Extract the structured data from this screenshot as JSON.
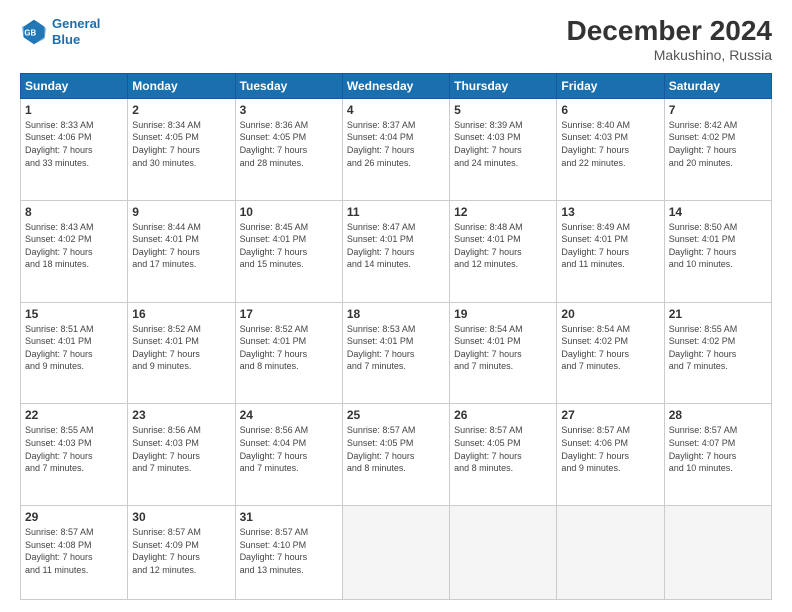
{
  "header": {
    "logo_line1": "General",
    "logo_line2": "Blue",
    "month": "December 2024",
    "location": "Makushino, Russia"
  },
  "weekdays": [
    "Sunday",
    "Monday",
    "Tuesday",
    "Wednesday",
    "Thursday",
    "Friday",
    "Saturday"
  ],
  "weeks": [
    [
      {
        "day": "1",
        "info": "Sunrise: 8:33 AM\nSunset: 4:06 PM\nDaylight: 7 hours\nand 33 minutes."
      },
      {
        "day": "2",
        "info": "Sunrise: 8:34 AM\nSunset: 4:05 PM\nDaylight: 7 hours\nand 30 minutes."
      },
      {
        "day": "3",
        "info": "Sunrise: 8:36 AM\nSunset: 4:05 PM\nDaylight: 7 hours\nand 28 minutes."
      },
      {
        "day": "4",
        "info": "Sunrise: 8:37 AM\nSunset: 4:04 PM\nDaylight: 7 hours\nand 26 minutes."
      },
      {
        "day": "5",
        "info": "Sunrise: 8:39 AM\nSunset: 4:03 PM\nDaylight: 7 hours\nand 24 minutes."
      },
      {
        "day": "6",
        "info": "Sunrise: 8:40 AM\nSunset: 4:03 PM\nDaylight: 7 hours\nand 22 minutes."
      },
      {
        "day": "7",
        "info": "Sunrise: 8:42 AM\nSunset: 4:02 PM\nDaylight: 7 hours\nand 20 minutes."
      }
    ],
    [
      {
        "day": "8",
        "info": "Sunrise: 8:43 AM\nSunset: 4:02 PM\nDaylight: 7 hours\nand 18 minutes."
      },
      {
        "day": "9",
        "info": "Sunrise: 8:44 AM\nSunset: 4:01 PM\nDaylight: 7 hours\nand 17 minutes."
      },
      {
        "day": "10",
        "info": "Sunrise: 8:45 AM\nSunset: 4:01 PM\nDaylight: 7 hours\nand 15 minutes."
      },
      {
        "day": "11",
        "info": "Sunrise: 8:47 AM\nSunset: 4:01 PM\nDaylight: 7 hours\nand 14 minutes."
      },
      {
        "day": "12",
        "info": "Sunrise: 8:48 AM\nSunset: 4:01 PM\nDaylight: 7 hours\nand 12 minutes."
      },
      {
        "day": "13",
        "info": "Sunrise: 8:49 AM\nSunset: 4:01 PM\nDaylight: 7 hours\nand 11 minutes."
      },
      {
        "day": "14",
        "info": "Sunrise: 8:50 AM\nSunset: 4:01 PM\nDaylight: 7 hours\nand 10 minutes."
      }
    ],
    [
      {
        "day": "15",
        "info": "Sunrise: 8:51 AM\nSunset: 4:01 PM\nDaylight: 7 hours\nand 9 minutes."
      },
      {
        "day": "16",
        "info": "Sunrise: 8:52 AM\nSunset: 4:01 PM\nDaylight: 7 hours\nand 9 minutes."
      },
      {
        "day": "17",
        "info": "Sunrise: 8:52 AM\nSunset: 4:01 PM\nDaylight: 7 hours\nand 8 minutes."
      },
      {
        "day": "18",
        "info": "Sunrise: 8:53 AM\nSunset: 4:01 PM\nDaylight: 7 hours\nand 7 minutes."
      },
      {
        "day": "19",
        "info": "Sunrise: 8:54 AM\nSunset: 4:01 PM\nDaylight: 7 hours\nand 7 minutes."
      },
      {
        "day": "20",
        "info": "Sunrise: 8:54 AM\nSunset: 4:02 PM\nDaylight: 7 hours\nand 7 minutes."
      },
      {
        "day": "21",
        "info": "Sunrise: 8:55 AM\nSunset: 4:02 PM\nDaylight: 7 hours\nand 7 minutes."
      }
    ],
    [
      {
        "day": "22",
        "info": "Sunrise: 8:55 AM\nSunset: 4:03 PM\nDaylight: 7 hours\nand 7 minutes."
      },
      {
        "day": "23",
        "info": "Sunrise: 8:56 AM\nSunset: 4:03 PM\nDaylight: 7 hours\nand 7 minutes."
      },
      {
        "day": "24",
        "info": "Sunrise: 8:56 AM\nSunset: 4:04 PM\nDaylight: 7 hours\nand 7 minutes."
      },
      {
        "day": "25",
        "info": "Sunrise: 8:57 AM\nSunset: 4:05 PM\nDaylight: 7 hours\nand 8 minutes."
      },
      {
        "day": "26",
        "info": "Sunrise: 8:57 AM\nSunset: 4:05 PM\nDaylight: 7 hours\nand 8 minutes."
      },
      {
        "day": "27",
        "info": "Sunrise: 8:57 AM\nSunset: 4:06 PM\nDaylight: 7 hours\nand 9 minutes."
      },
      {
        "day": "28",
        "info": "Sunrise: 8:57 AM\nSunset: 4:07 PM\nDaylight: 7 hours\nand 10 minutes."
      }
    ],
    [
      {
        "day": "29",
        "info": "Sunrise: 8:57 AM\nSunset: 4:08 PM\nDaylight: 7 hours\nand 11 minutes."
      },
      {
        "day": "30",
        "info": "Sunrise: 8:57 AM\nSunset: 4:09 PM\nDaylight: 7 hours\nand 12 minutes."
      },
      {
        "day": "31",
        "info": "Sunrise: 8:57 AM\nSunset: 4:10 PM\nDaylight: 7 hours\nand 13 minutes."
      },
      null,
      null,
      null,
      null
    ]
  ]
}
